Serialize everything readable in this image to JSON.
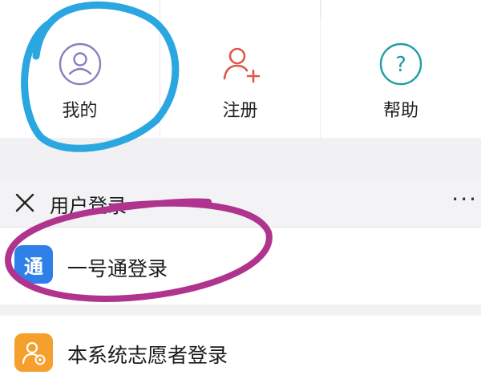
{
  "grid": {
    "items": [
      {
        "label": "我的",
        "icon": "user-circle-icon",
        "color": "#8c7dc0"
      },
      {
        "label": "注册",
        "icon": "user-add-icon",
        "color": "#e0574b"
      },
      {
        "label": "帮助",
        "icon": "help-circle-icon",
        "color": "#1f9c9f",
        "glyph": "?"
      }
    ]
  },
  "login_sheet": {
    "title": "用户登录",
    "more": "···",
    "options": [
      {
        "label": "一号通登录",
        "icon": "yihaotong-app-icon",
        "glyph": "通",
        "color": "#2f7fe8"
      },
      {
        "label": "本系统志愿者登录",
        "icon": "volunteer-app-icon",
        "color": "#f5a02c"
      }
    ]
  },
  "annotations": {
    "circle_blue": "#2aa6e0",
    "circle_magenta": "#b0338e"
  }
}
